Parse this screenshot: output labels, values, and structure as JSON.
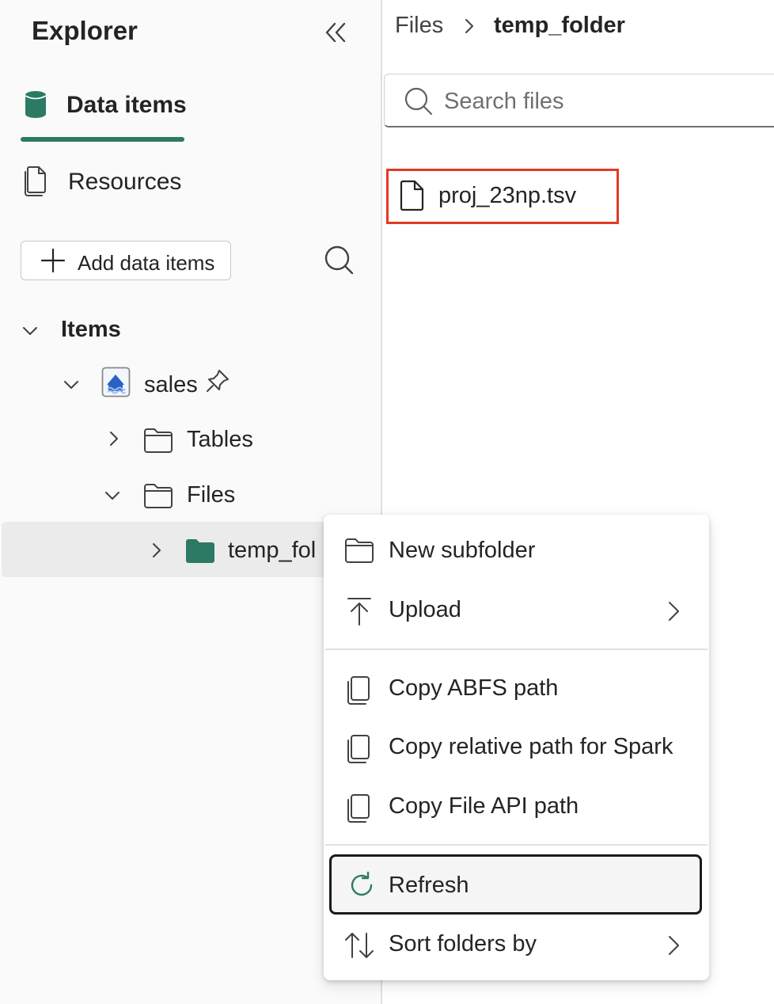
{
  "explorer": {
    "title": "Explorer",
    "nav": {
      "data_items": "Data items",
      "resources": "Resources"
    },
    "add_button": "Add data items",
    "tree": {
      "items_label": "Items",
      "sales": "sales",
      "tables": "Tables",
      "files": "Files",
      "temp_folder": "temp_fol"
    }
  },
  "breadcrumb": {
    "root": "Files",
    "current": "temp_folder"
  },
  "search": {
    "placeholder": "Search files"
  },
  "files": [
    {
      "name": "proj_23np.tsv"
    }
  ],
  "context_menu": {
    "items": [
      {
        "label": "New subfolder"
      },
      {
        "label": "Upload"
      },
      {
        "label": "Copy ABFS path"
      },
      {
        "label": "Copy relative path for Spark"
      },
      {
        "label": "Copy File API path"
      },
      {
        "label": "Refresh"
      },
      {
        "label": "Sort folders by"
      }
    ]
  },
  "colors": {
    "accent": "#2d7a64",
    "highlight_box": "#e23a22",
    "selected_row": "#ebebeb"
  }
}
